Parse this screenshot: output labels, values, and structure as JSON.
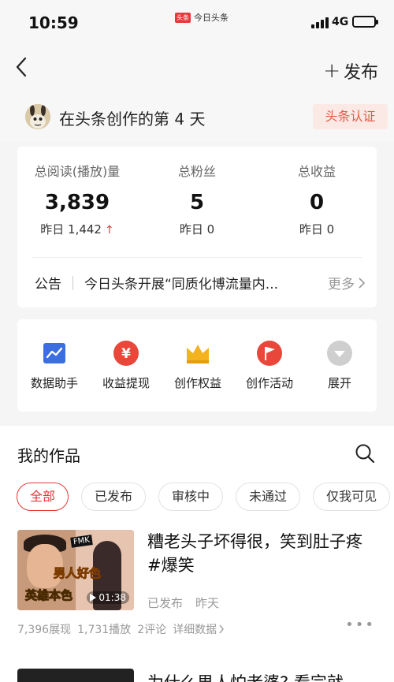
{
  "status_bar": {
    "time": "10:59",
    "notification_logo": "头条",
    "notification_app": "今日头条",
    "network": "4G"
  },
  "nav": {
    "back_icon": "chevron-left-icon",
    "publish_plus": "+",
    "publish_label": "发布"
  },
  "creator": {
    "text": "在头条创作的第 4 天",
    "verify_label": "头条认证"
  },
  "stats": [
    {
      "label": "总阅读(播放)量",
      "value": "3,839",
      "yesterday": "昨日 1,442",
      "trend": "up"
    },
    {
      "label": "总粉丝",
      "value": "5",
      "yesterday": "昨日 0"
    },
    {
      "label": "总收益",
      "value": "0",
      "yesterday": "昨日 0"
    }
  ],
  "notice": {
    "label": "公告",
    "text": "今日头条开展“同质化博流量内...",
    "more": "更多"
  },
  "tools": [
    {
      "label": "数据助手",
      "icon": "chart-icon",
      "color": "#3b6fe0"
    },
    {
      "label": "收益提现",
      "icon": "yuan-icon",
      "color": "#e8473a"
    },
    {
      "label": "创作权益",
      "icon": "crown-icon",
      "color": "#f5b21f"
    },
    {
      "label": "创作活动",
      "icon": "flag-icon",
      "color": "#e8473a"
    },
    {
      "label": "展开",
      "icon": "expand-icon",
      "color": "#cfcfcf"
    }
  ],
  "works": {
    "title": "我的作品",
    "filters": [
      "全部",
      "已发布",
      "审核中",
      "未通过",
      "仅我可见"
    ],
    "active_filter": 0,
    "items": [
      {
        "title": "糟老头子坏得很，笑到肚子疼#爆笑",
        "status": "已发布",
        "time": "昨天",
        "thumb_caption_1": "男人好色",
        "thumb_caption_2": "英雄本色",
        "duration": "01:38",
        "impressions": "7,396展现",
        "plays": "1,731播放",
        "comments": "2评论",
        "detail": "详细数据"
      },
      {
        "title": "为什么男人怕老婆? 看完就"
      }
    ]
  },
  "colors": {
    "accent": "#e8373a",
    "verify_bg": "#fbe9e6"
  }
}
